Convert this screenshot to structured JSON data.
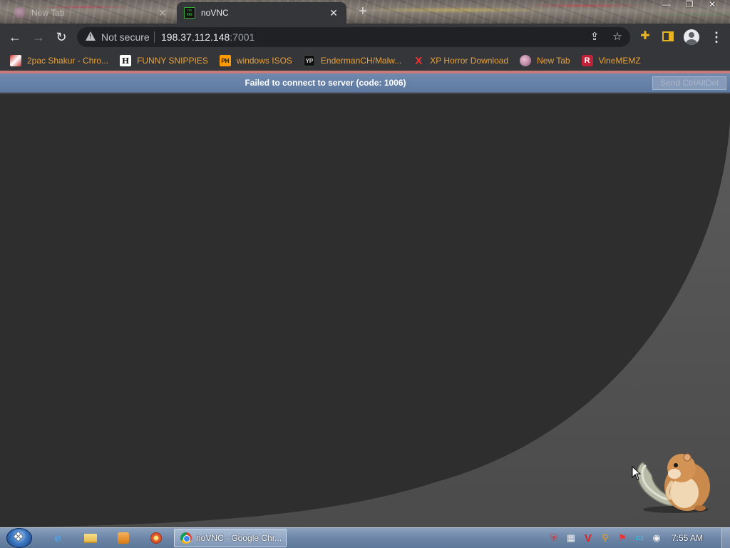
{
  "browser": {
    "tabs": [
      {
        "title": "New Tab",
        "active": false
      },
      {
        "title": "noVNC",
        "active": true
      }
    ],
    "new_tab_glyph": "+",
    "window_controls": [
      "minimize-icon",
      "restore-icon",
      "close-icon"
    ],
    "address_bar": {
      "security_label": "Not secure",
      "host": "198.37.112.148",
      "port": ":7001"
    },
    "bookmarks": [
      {
        "label": "2pac Shakur - Chro...",
        "icon": "2pac-favicon"
      },
      {
        "label": "FUNNY SNIPPIES",
        "icon": "h-favicon",
        "icon_text": "H"
      },
      {
        "label": "windows ISOS",
        "icon": "ph-favicon",
        "icon_text": "PH"
      },
      {
        "label": "EndermanCH/Malw...",
        "icon": "yp-favicon",
        "icon_text": "YP"
      },
      {
        "label": "XP Horror Download",
        "icon": "x-favicon",
        "icon_text": "X"
      },
      {
        "label": "New Tab",
        "icon": "newtab-favicon"
      },
      {
        "label": "VineMEMZ",
        "icon": "r-favicon",
        "icon_text": "R"
      }
    ],
    "bookmark_color": "#e8a23b"
  },
  "novnc": {
    "status_message": "Failed to connect to server (code: 1006)",
    "ctrl_alt_del_label": "Send CtrlAltDel",
    "status_bar_color": "#6f88ad"
  },
  "taskbar": {
    "pinned": [
      "internet-explorer-icon",
      "explorer-folder-icon",
      "media-player-icon",
      "app-icon"
    ],
    "ie_glyph": "e",
    "running_task": "noVNC - Google Chr...",
    "tray_icons": [
      "security-icon",
      "chip-icon",
      "v-icon",
      "search-tool-icon",
      "flag-icon",
      "display-icon",
      "record-icon"
    ],
    "clock": "7:55 AM"
  }
}
